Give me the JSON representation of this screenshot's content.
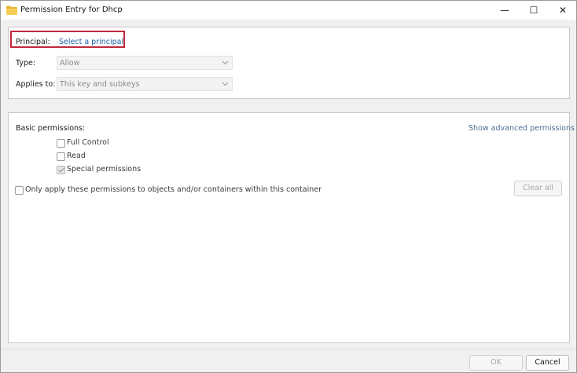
{
  "window": {
    "title": "Permission Entry for Dhcp",
    "controls": {
      "minimize": "—",
      "maximize": "☐",
      "close": "✕"
    }
  },
  "principal": {
    "label": "Principal:",
    "link": "Select a principal"
  },
  "type": {
    "label": "Type:",
    "value": "Allow"
  },
  "applies_to": {
    "label": "Applies to:",
    "value": "This key and subkeys"
  },
  "permissions": {
    "heading": "Basic permissions:",
    "advanced_link": "Show advanced permissions",
    "items": [
      {
        "label": "Full Control",
        "checked": false
      },
      {
        "label": "Read",
        "checked": false
      },
      {
        "label": "Special permissions",
        "checked": true,
        "disabled": true
      }
    ],
    "only_apply_label": "Only apply these permissions to objects and/or containers within this container",
    "clear_all": "Clear all"
  },
  "buttons": {
    "ok": "OK",
    "cancel": "Cancel"
  },
  "icons": {
    "folder": "folder-icon",
    "dropdown": "chevron-down-icon"
  },
  "colors": {
    "link": "#1a5fa8",
    "highlight": "#c0283b",
    "folder": "#f3c043"
  }
}
